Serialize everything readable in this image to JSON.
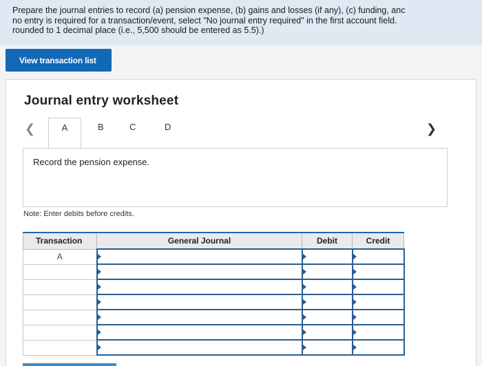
{
  "instructions": {
    "line1": "Prepare the journal entries to record (a) pension expense, (b) gains and losses (if any), (c) funding, anc",
    "line2": "no entry is required for a transaction/event, select \"No journal entry required\" in the first account field.",
    "line3": "rounded to 1 decimal place (i.e., 5,500 should be entered as 5.5).)"
  },
  "view_button": "View transaction list",
  "worksheet": {
    "title": "Journal entry worksheet",
    "tabs": [
      "A",
      "B",
      "C",
      "D"
    ],
    "prompt": "Record the pension expense.",
    "note": "Note: Enter debits before credits.",
    "headers": {
      "transaction": "Transaction",
      "journal": "General Journal",
      "debit": "Debit",
      "credit": "Credit"
    },
    "rows": [
      {
        "transaction": "A"
      },
      {
        "transaction": ""
      },
      {
        "transaction": ""
      },
      {
        "transaction": ""
      },
      {
        "transaction": ""
      },
      {
        "transaction": ""
      },
      {
        "transaction": ""
      }
    ]
  },
  "icons": {
    "prev": "chevron-left-icon",
    "next": "chevron-right-icon"
  }
}
